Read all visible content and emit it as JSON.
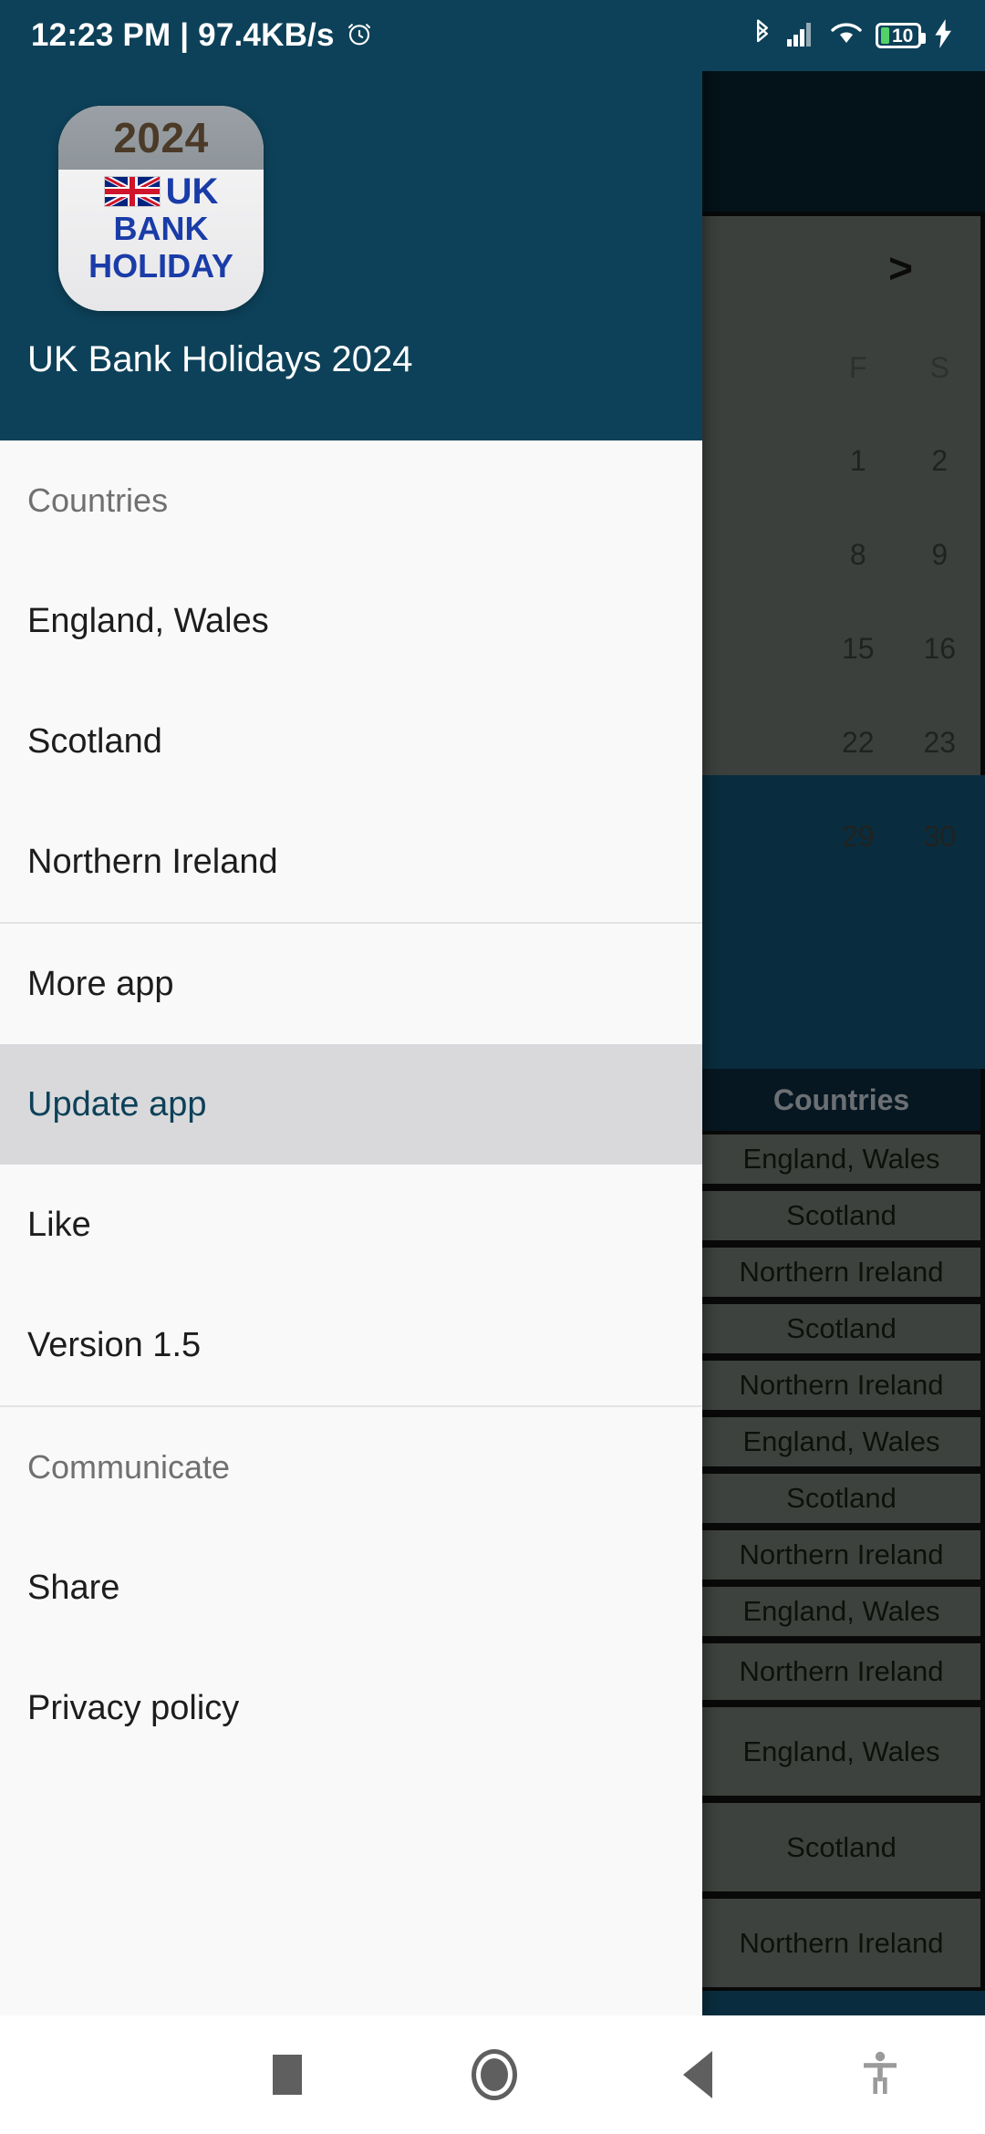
{
  "status_bar": {
    "clock": "12:23 PM | 97.4KB/s",
    "alarm_icon": "alarm-clock-icon",
    "bluetooth_icon": "bluetooth-icon",
    "signal_icon": "cellular-signal-icon",
    "wifi_icon": "wifi-icon",
    "battery_level": "10",
    "charging_icon": "charging-bolt-icon",
    "background_color": "#0d4159",
    "text_color": "#ffffff"
  },
  "drawer": {
    "header": {
      "app_title": "UK Bank Holidays 2024",
      "icon": {
        "year": "2024",
        "flag": "uk-flag-icon",
        "line_uk": "UK",
        "line_bank": "BANK",
        "line_holiday": "HOLIDAY"
      },
      "background_color": "#0d4159"
    },
    "sections": [
      {
        "label": "Countries",
        "items": [
          {
            "label": "England, Wales",
            "selected": false
          },
          {
            "label": "Scotland",
            "selected": false
          },
          {
            "label": "Northern Ireland",
            "selected": false
          }
        ]
      },
      {
        "label": "",
        "items": [
          {
            "label": "More app",
            "selected": false
          },
          {
            "label": "Update app",
            "selected": true
          },
          {
            "label": "Like",
            "selected": false
          },
          {
            "label": "Version 1.5",
            "selected": false
          }
        ]
      },
      {
        "label": "Communicate",
        "items": [
          {
            "label": "Share",
            "selected": false
          },
          {
            "label": "Privacy policy",
            "selected": false
          }
        ]
      }
    ],
    "selected_item_background": "#d9d9db",
    "selected_item_color": "#0d4159"
  },
  "background_app": {
    "toolbar_color": "#061a25",
    "calendar": {
      "next_month_icon": ">",
      "day_headers": [
        "F",
        "S"
      ],
      "weeks": [
        [
          "1",
          "2"
        ],
        [
          "8",
          "9"
        ],
        [
          "15",
          "16"
        ],
        [
          "22",
          "23"
        ],
        [
          "29",
          "30"
        ]
      ]
    },
    "countries_header": "Countries",
    "country_rows": [
      "England, Wales",
      "Scotland",
      "Northern Ireland",
      "Scotland",
      "Northern Ireland",
      "England, Wales",
      "Scotland",
      "Northern Ireland",
      "England, Wales",
      "Northern Ireland",
      "England, Wales",
      "Scotland",
      "Northern Ireland"
    ]
  },
  "nav_bar": {
    "recents_icon": "square-recents-icon",
    "home_icon": "circle-home-icon",
    "back_icon": "triangle-back-icon",
    "accessibility_icon": "accessibility-icon"
  }
}
